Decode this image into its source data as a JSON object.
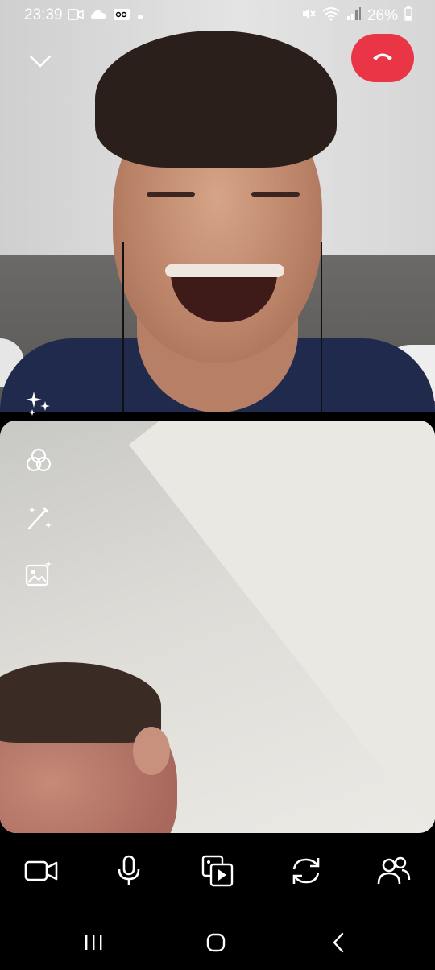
{
  "status_bar": {
    "time": "23:39",
    "battery": "26%",
    "icons_left": [
      "video-icon",
      "cloud-icon",
      "voicemail-icon",
      "dot-icon"
    ],
    "icons_right": [
      "mute-icon",
      "wifi-icon",
      "signal-icon",
      "battery-icon"
    ]
  },
  "remote_video": {
    "controls": [
      "chevron-down-icon",
      "end-call-icon",
      "sparkles-icon"
    ]
  },
  "self_view": {
    "side_tools": [
      "effects-circles-icon",
      "magic-wand-icon",
      "photo-sparkle-icon"
    ]
  },
  "call_bar": {
    "buttons": [
      "video-camera-icon",
      "microphone-icon",
      "media-share-icon",
      "flip-camera-icon",
      "participants-icon"
    ]
  },
  "colors": {
    "end_call": "#e93545",
    "background": "#000000"
  }
}
